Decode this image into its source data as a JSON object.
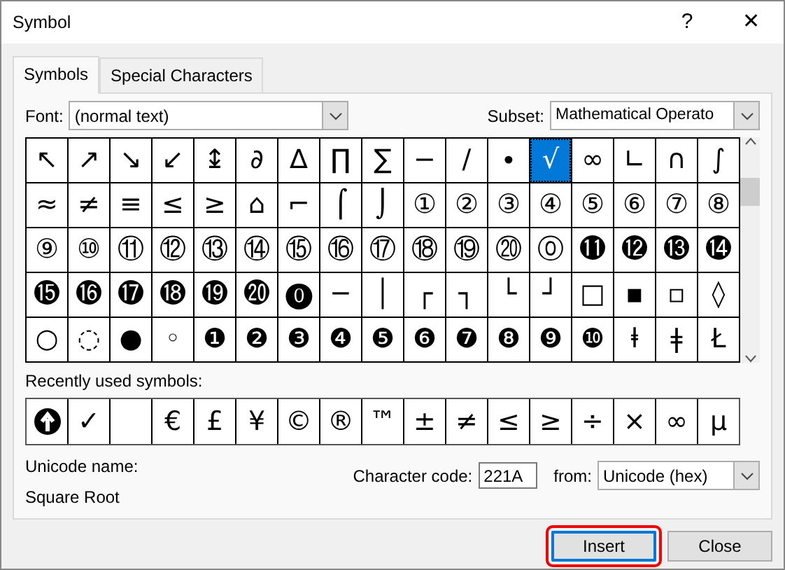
{
  "window": {
    "title": "Symbol",
    "help": "?",
    "close": "✕"
  },
  "tabs": [
    {
      "label": "Symbols",
      "selected": true
    },
    {
      "label": "Special Characters",
      "selected": false
    }
  ],
  "font": {
    "label": "Font:",
    "value": "(normal text)"
  },
  "subset": {
    "label": "Subset:",
    "value": "Mathematical Operato"
  },
  "grid": [
    [
      {
        "s": "↖",
        "selected": false
      },
      {
        "s": "↗",
        "selected": false
      },
      {
        "s": "↘",
        "selected": false
      },
      {
        "s": "↙",
        "selected": false
      },
      {
        "s": "↨",
        "selected": false
      },
      {
        "s": "∂",
        "selected": false
      },
      {
        "s": "∆",
        "selected": false
      },
      {
        "s": "∏",
        "selected": false
      },
      {
        "s": "∑",
        "selected": false
      },
      {
        "s": "−",
        "selected": false
      },
      {
        "s": "∕",
        "selected": false
      },
      {
        "s": "∙",
        "selected": false
      },
      {
        "s": "√",
        "selected": true
      },
      {
        "s": "∞",
        "selected": false
      },
      {
        "s": "∟",
        "selected": false
      },
      {
        "s": "∩",
        "selected": false
      },
      {
        "s": "∫",
        "selected": false
      }
    ],
    [
      {
        "s": "≈",
        "selected": false
      },
      {
        "s": "≠",
        "selected": false
      },
      {
        "s": "≡",
        "selected": false
      },
      {
        "s": "≤",
        "selected": false
      },
      {
        "s": "≥",
        "selected": false
      },
      {
        "s": "⌂",
        "selected": false
      },
      {
        "s": "⌐",
        "selected": false
      },
      {
        "s": "⌠",
        "selected": false
      },
      {
        "s": "⌡",
        "selected": false
      },
      {
        "s": "①",
        "selected": false
      },
      {
        "s": "②",
        "selected": false
      },
      {
        "s": "③",
        "selected": false
      },
      {
        "s": "④",
        "selected": false
      },
      {
        "s": "⑤",
        "selected": false
      },
      {
        "s": "⑥",
        "selected": false
      },
      {
        "s": "⑦",
        "selected": false
      },
      {
        "s": "⑧",
        "selected": false
      }
    ],
    [
      {
        "s": "⑨",
        "selected": false
      },
      {
        "s": "⑩",
        "selected": false
      },
      {
        "s": "⑪",
        "selected": false
      },
      {
        "s": "⑫",
        "selected": false
      },
      {
        "s": "⑬",
        "selected": false
      },
      {
        "s": "⑭",
        "selected": false
      },
      {
        "s": "⑮",
        "selected": false
      },
      {
        "s": "⑯",
        "selected": false
      },
      {
        "s": "⑰",
        "selected": false
      },
      {
        "s": "⑱",
        "selected": false
      },
      {
        "s": "⑲",
        "selected": false
      },
      {
        "s": "⑳",
        "selected": false
      },
      {
        "s": "⓪",
        "selected": false
      },
      {
        "s": "⓫",
        "selected": false
      },
      {
        "s": "⓬",
        "selected": false
      },
      {
        "s": "⓭",
        "selected": false
      },
      {
        "s": "⓮",
        "selected": false
      }
    ],
    [
      {
        "s": "⓯",
        "selected": false
      },
      {
        "s": "⓰",
        "selected": false
      },
      {
        "s": "⓱",
        "selected": false
      },
      {
        "s": "⓲",
        "selected": false
      },
      {
        "s": "⓳",
        "selected": false
      },
      {
        "s": "⓴",
        "selected": false
      },
      {
        "s": "⓿",
        "selected": false
      },
      {
        "s": "─",
        "selected": false
      },
      {
        "s": "│",
        "selected": false
      },
      {
        "s": "┌",
        "selected": false
      },
      {
        "s": "┐",
        "selected": false
      },
      {
        "s": "└",
        "selected": false
      },
      {
        "s": "┘",
        "selected": false
      },
      {
        "s": "□",
        "selected": false
      },
      {
        "s": "▪",
        "selected": false
      },
      {
        "s": "▫",
        "selected": false
      },
      {
        "s": "◊",
        "selected": false
      }
    ],
    [
      {
        "s": "○",
        "selected": false
      },
      {
        "s": "◌",
        "selected": false
      },
      {
        "s": "●",
        "selected": false
      },
      {
        "s": "◦",
        "selected": false
      },
      {
        "s": "❶",
        "selected": false
      },
      {
        "s": "❷",
        "selected": false
      },
      {
        "s": "❸",
        "selected": false
      },
      {
        "s": "❹",
        "selected": false
      },
      {
        "s": "❺",
        "selected": false
      },
      {
        "s": "❻",
        "selected": false
      },
      {
        "s": "❼",
        "selected": false
      },
      {
        "s": "❽",
        "selected": false
      },
      {
        "s": "❾",
        "selected": false
      },
      {
        "s": "❿",
        "selected": false
      },
      {
        "s": "ⱡ",
        "selected": false
      },
      {
        "s": "ǂ",
        "selected": false
      },
      {
        "s": "Ł",
        "selected": false
      }
    ]
  ],
  "recent": {
    "label": "Recently used symbols:",
    "items": [
      {
        "kind": "icon"
      },
      {
        "kind": "char",
        "s": "✓"
      },
      {
        "kind": "empty"
      },
      {
        "kind": "char",
        "s": "€"
      },
      {
        "kind": "char",
        "s": "£"
      },
      {
        "kind": "char",
        "s": "¥"
      },
      {
        "kind": "char",
        "s": "©"
      },
      {
        "kind": "char",
        "s": "®"
      },
      {
        "kind": "char",
        "s": "™"
      },
      {
        "kind": "char",
        "s": "±"
      },
      {
        "kind": "char",
        "s": "≠"
      },
      {
        "kind": "char",
        "s": "≤"
      },
      {
        "kind": "char",
        "s": "≥"
      },
      {
        "kind": "char",
        "s": "÷"
      },
      {
        "kind": "char",
        "s": "×"
      },
      {
        "kind": "char",
        "s": "∞"
      },
      {
        "kind": "char",
        "s": "μ"
      }
    ]
  },
  "unicode_name": {
    "label": "Unicode name:",
    "value": "Square Root"
  },
  "character_code": {
    "label": "Character code:",
    "value": "221A"
  },
  "from": {
    "label": "from:",
    "value": "Unicode (hex)"
  },
  "buttons": [
    {
      "label": "Insert",
      "default": true
    },
    {
      "label": "Close",
      "default": false
    }
  ]
}
